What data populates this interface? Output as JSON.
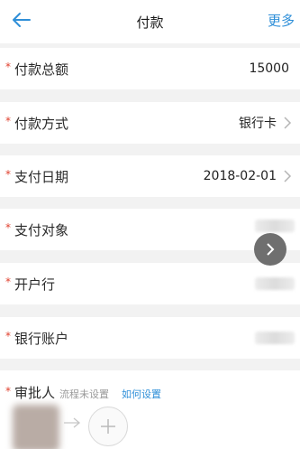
{
  "header": {
    "title": "付款",
    "more_label": "更多",
    "back_icon": "back-arrow-icon",
    "accent": "#2f8fd8"
  },
  "fields": [
    {
      "label": "付款总额",
      "value": "15000",
      "required": "*"
    },
    {
      "label": "付款方式",
      "value": "银行卡",
      "required": "*"
    },
    {
      "label": "支付日期",
      "value": "2018-02-01",
      "required": "*"
    },
    {
      "label": "支付对象",
      "value": "",
      "required": "*"
    },
    {
      "label": "开户行",
      "value": "",
      "required": "*"
    },
    {
      "label": "银行账户",
      "value": "",
      "required": "*"
    }
  ],
  "approver": {
    "label": "审批人",
    "required": "*",
    "hint": "流程未设置",
    "link": "如何设置"
  },
  "colors": {
    "required": "#e0412f",
    "link": "#2f8fd8",
    "background": "#f2f2f2"
  }
}
